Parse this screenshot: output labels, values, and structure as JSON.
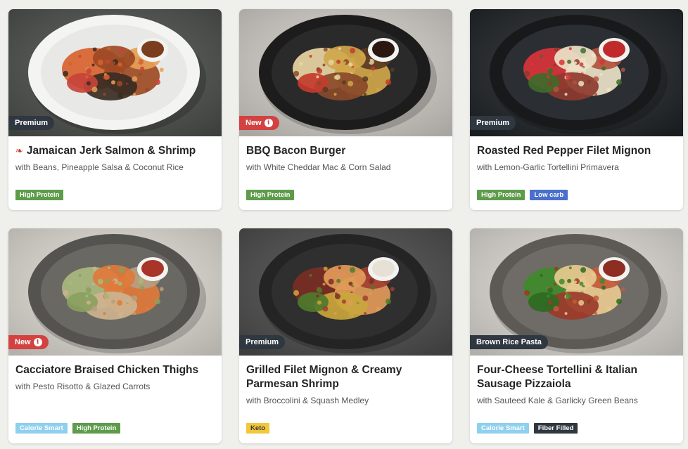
{
  "meals": [
    {
      "tag": "Premium",
      "tag_style": "dark",
      "title": "Jamaican Jerk Salmon & Shrimp",
      "spicy": true,
      "subtitle": "with Beans, Pineapple Salsa & Coconut Rice",
      "badges": [
        {
          "label": "High Protein",
          "bg": "#5e9b4b",
          "fg": "#ffffff"
        }
      ],
      "image": {
        "bg": "#4b4e4b",
        "plate": "#e8e8e6",
        "rim": "#f4f4f2",
        "food": [
          "#d7622f",
          "#9c4a24",
          "#3a2b22",
          "#c7443a",
          "#e59f57"
        ],
        "sauce": "#7a3d1e"
      }
    },
    {
      "tag": "New",
      "tag_style": "red",
      "tag_info": true,
      "title": "BBQ Bacon Burger",
      "subtitle": "with White Cheddar Mac & Corn Salad",
      "badges": [
        {
          "label": "High Protein",
          "bg": "#5e9b4b",
          "fg": "#ffffff"
        }
      ],
      "image": {
        "bg": "#cfcbc5",
        "plate": "#2a2a2a",
        "rim": "#1c1c1c",
        "food": [
          "#e8d5a3",
          "#d0a64a",
          "#8a4a2a",
          "#c43b2c",
          "#5a3a24"
        ],
        "sauce": "#2b1710"
      }
    },
    {
      "tag": "Premium",
      "tag_style": "dark",
      "title": "Roasted Red Pepper Filet Mignon",
      "subtitle": "with Lemon-Garlic Tortellini Primavera",
      "badges": [
        {
          "label": "High Protein",
          "bg": "#5e9b4b",
          "fg": "#ffffff"
        },
        {
          "label": "Low carb",
          "bg": "#4a6fcc",
          "fg": "#ffffff"
        }
      ],
      "image": {
        "bg": "#1f2326",
        "plate": "#2b2f33",
        "rim": "#17191b",
        "food": [
          "#d8343a",
          "#ece2c8",
          "#8d3b2e",
          "#3f6b2a",
          "#b0523c"
        ],
        "sauce": "#c02a2a"
      }
    },
    {
      "tag": "New",
      "tag_style": "red",
      "tag_info": true,
      "title": "Cacciatore Braised Chicken Thighs",
      "subtitle": "with Pesto Risotto & Glazed Carrots",
      "badges": [
        {
          "label": "Calorie Smart",
          "bg": "#8fd0ef",
          "fg": "#ffffff"
        },
        {
          "label": "High Protein",
          "bg": "#5e9b4b",
          "fg": "#ffffff"
        }
      ],
      "image": {
        "bg": "#dcd8d1",
        "plate": "#6a6863",
        "rim": "#55534f",
        "food": [
          "#a9b97d",
          "#e07a39",
          "#cdb38f",
          "#8aa060",
          "#b5a080"
        ],
        "sauce": "#a8342a"
      }
    },
    {
      "tag": "Premium",
      "tag_style": "dark",
      "title": "Grilled Filet Mignon & Creamy Parmesan Shrimp",
      "subtitle": "with Broccolini & Squash Medley",
      "badges": [
        {
          "label": "Keto",
          "bg": "#f2c73a",
          "fg": "#3a3a3a"
        }
      ],
      "image": {
        "bg": "#4a4b4a",
        "plate": "#2e2f2e",
        "rim": "#232423",
        "food": [
          "#7a2e24",
          "#e29a5a",
          "#c9a63c",
          "#4f7a2c",
          "#a04030"
        ],
        "sauce": "#e6e1d4"
      }
    },
    {
      "tag": "Brown Rice Pasta",
      "tag_style": "dark",
      "title": "Four-Cheese Tortellini & Italian Sausage Pizzaiola",
      "subtitle": "with Sauteed Kale & Garlicky Green Beans",
      "badges": [
        {
          "label": "Calorie Smart",
          "bg": "#8fd0ef",
          "fg": "#ffffff"
        },
        {
          "label": "Fiber Filled",
          "bg": "#2f3740",
          "fg": "#ffffff"
        }
      ],
      "image": {
        "bg": "#d9d6d0",
        "plate": "#6f6c67",
        "rim": "#5d5a56",
        "food": [
          "#3f8a2b",
          "#e7c98f",
          "#9c3a2a",
          "#2f6a22",
          "#c25a3a"
        ],
        "sauce": "#8e2d22"
      }
    }
  ]
}
